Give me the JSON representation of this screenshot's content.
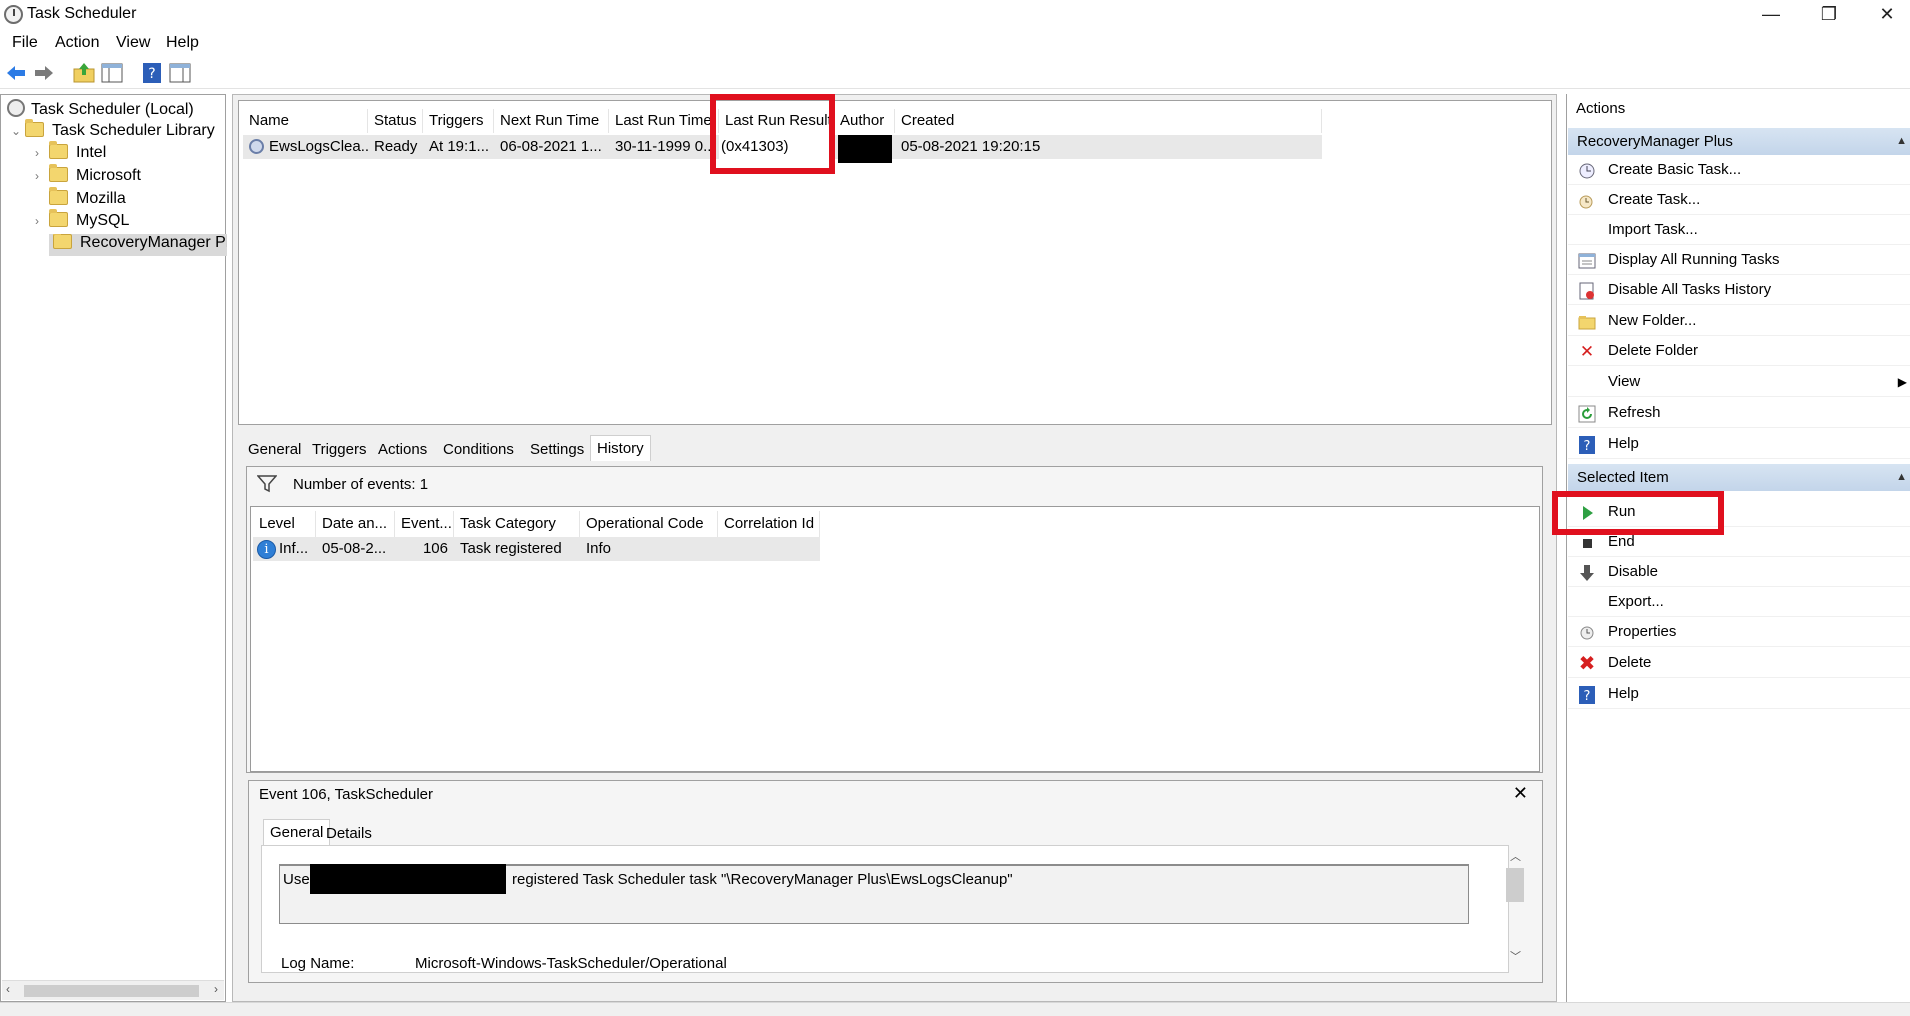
{
  "window": {
    "title": "Task Scheduler",
    "minimize": "—",
    "restore": "❐",
    "close": "✕"
  },
  "menu": [
    "File",
    "Action",
    "View",
    "Help"
  ],
  "tree": {
    "root": "Task Scheduler (Local)",
    "library": "Task Scheduler Library",
    "folders": [
      "Intel",
      "Microsoft",
      "Mozilla",
      "MySQL",
      "RecoveryManager Plus"
    ]
  },
  "tasklist": {
    "columns": [
      "Name",
      "Status",
      "Triggers",
      "Next Run Time",
      "Last Run Time",
      "Last Run Result",
      "Author",
      "Created"
    ],
    "row": {
      "name": "EwsLogsClea...",
      "status": "Ready",
      "triggers": "At 19:1...",
      "next_run": "06-08-2021 1...",
      "last_run": "30-11-1999 0...",
      "last_result": "(0x41303)",
      "author": "",
      "created": "05-08-2021 19:20:15"
    }
  },
  "tabs": [
    "General",
    "Triggers",
    "Actions",
    "Conditions",
    "Settings",
    "History"
  ],
  "history": {
    "events_label": "Number of events: 1",
    "columns": [
      "Level",
      "Date an...",
      "Event...",
      "Task Category",
      "Operational Code",
      "Correlation Id"
    ],
    "row": {
      "level": "Inf...",
      "date": "05-08-2...",
      "event": "106",
      "category": "Task registered",
      "opcode": "Info",
      "correlation": ""
    }
  },
  "event_detail": {
    "title": "Event 106, TaskScheduler",
    "tabs": [
      "General",
      "Details"
    ],
    "message_prefix": "Use",
    "message_suffix": "registered Task Scheduler task \"\\RecoveryManager Plus\\EwsLogsCleanup\"",
    "log_name_label": "Log Name:",
    "log_name_value": "Microsoft-Windows-TaskScheduler/Operational"
  },
  "actions_pane": {
    "header": "Actions",
    "section1": {
      "title": "RecoveryManager Plus",
      "items": [
        "Create Basic Task...",
        "Create Task...",
        "Import Task...",
        "Display All Running Tasks",
        "Disable All Tasks History",
        "New Folder...",
        "Delete Folder",
        "View",
        "Refresh",
        "Help"
      ]
    },
    "section2": {
      "title": "Selected Item",
      "items": [
        "Run",
        "End",
        "Disable",
        "Export...",
        "Properties",
        "Delete",
        "Help"
      ]
    }
  },
  "colors": {
    "highlight_red": "#e0101e",
    "section_blue": "#c9daee"
  }
}
